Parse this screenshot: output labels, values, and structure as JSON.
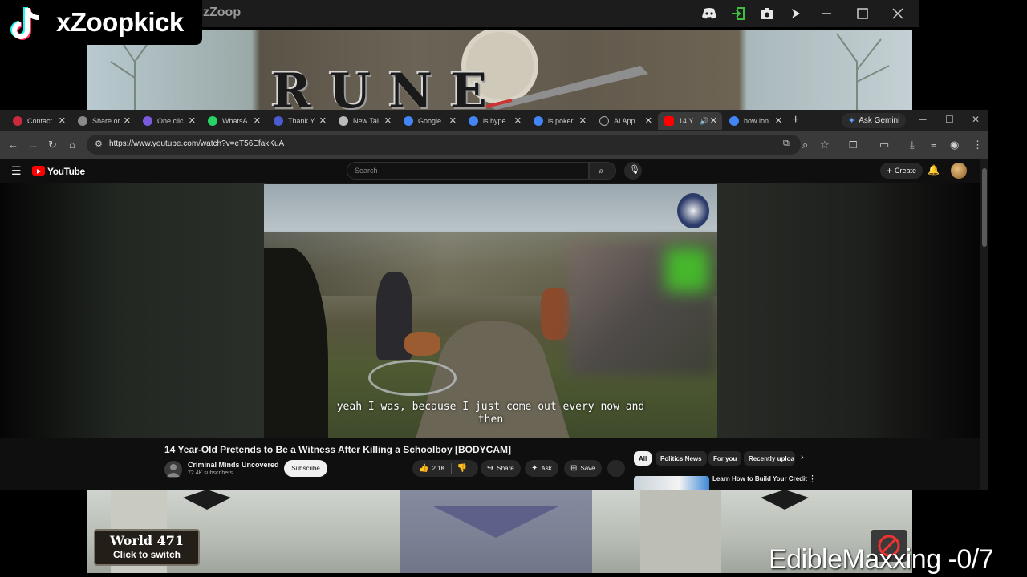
{
  "game": {
    "title_fragment": "zZoop",
    "logo_text": "RUNE"
  },
  "tiktok": {
    "username": "xZoopkick"
  },
  "chrome": {
    "tabs": [
      {
        "label": "Contact",
        "favicon_color": "#c92a3c"
      },
      {
        "label": "Share or",
        "favicon_color": "#8a8a8a"
      },
      {
        "label": "One clic",
        "favicon_color": "#7a5be0"
      },
      {
        "label": "WhatsA",
        "favicon_color": "#25d366"
      },
      {
        "label": "Thank Y",
        "favicon_color": "#4a5bd0"
      },
      {
        "label": "New Tal",
        "favicon_color": "#bbbbbb"
      },
      {
        "label": "Google",
        "favicon_color": "#4285f4"
      },
      {
        "label": "is hype",
        "favicon_color": "#4285f4"
      },
      {
        "label": "is poker",
        "favicon_color": "#4285f4"
      },
      {
        "label": "AI App",
        "favicon_color": "#222222"
      },
      {
        "label": "14 Y",
        "favicon_color": "#ff0000"
      },
      {
        "label": "how lon",
        "favicon_color": "#4285f4"
      }
    ],
    "new_tab_symbol": "+",
    "ask_gemini": "Ask Gemini",
    "url": "https://www.youtube.com/watch?v=eT56EfakKuA"
  },
  "youtube": {
    "logo": "YouTube",
    "search_placeholder": "Search",
    "create_label": "Create",
    "video": {
      "subtitle_line1": "yeah I was, because I just come out every now and",
      "subtitle_line2": "then"
    },
    "title": "14 Year-Old Pretends to Be a Witness After Killing a Schoolboy [BODYCAM]",
    "channel": {
      "name": "Criminal Minds Uncovered",
      "subscribers": "72.4K subscribers"
    },
    "subscribe": "Subscribe",
    "actions": {
      "likes": "2.1K",
      "share": "Share",
      "ask": "Ask",
      "save": "Save",
      "more": "..."
    },
    "chips": [
      "All",
      "Politics News",
      "For you",
      "Recently uploa"
    ],
    "recommended": {
      "title": "Learn How to Build Your Credit"
    }
  },
  "overlay": {
    "world_label": "World 471",
    "world_sub": "Click to switch",
    "edible": "EdibleMaxxing -0/7"
  }
}
